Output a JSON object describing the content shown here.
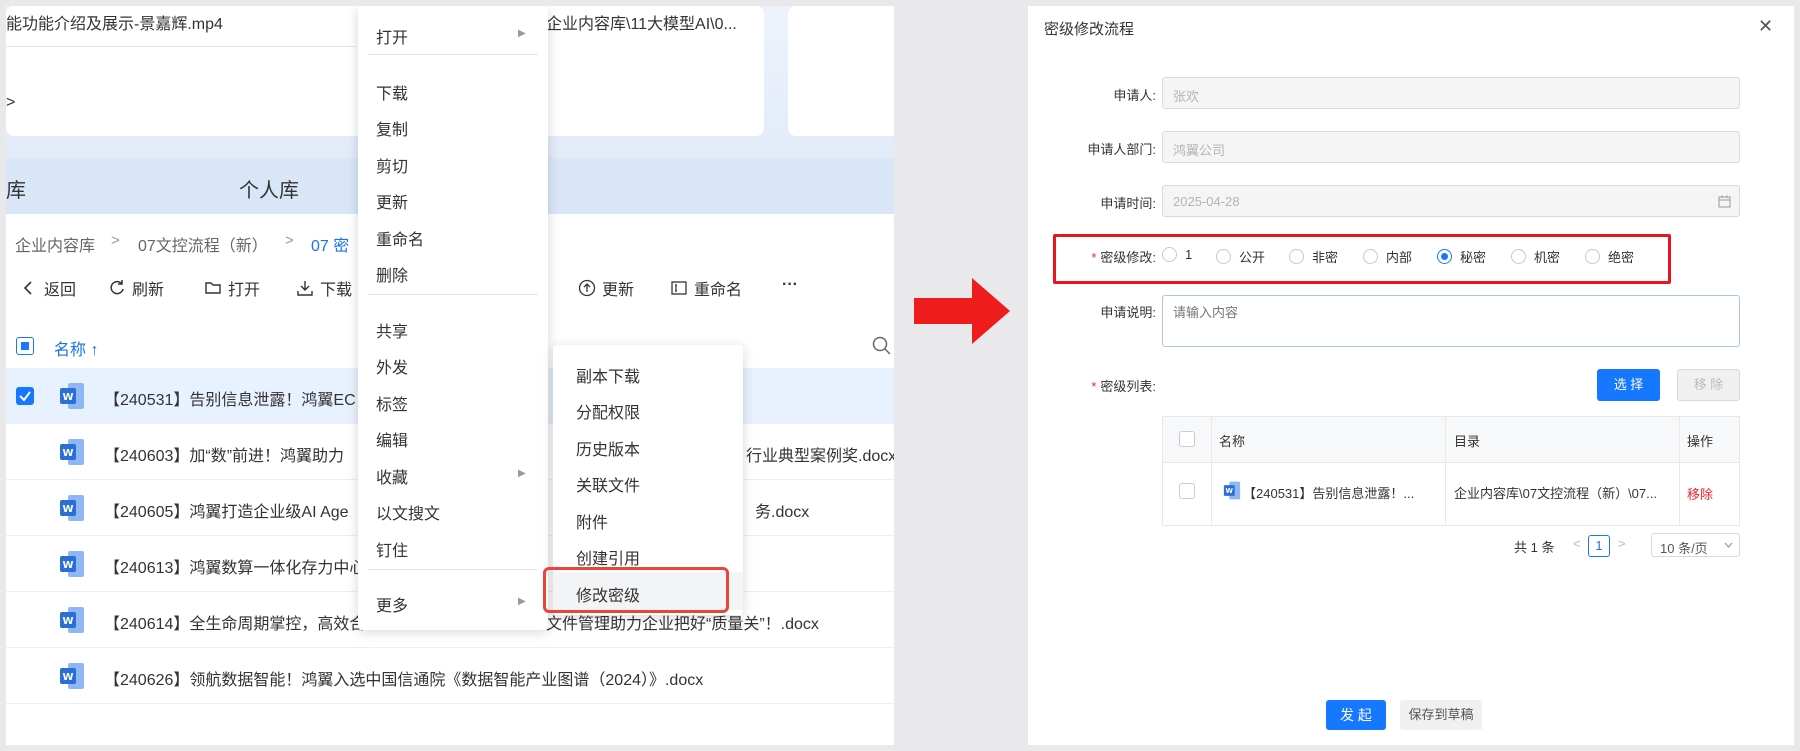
{
  "left_panel": {
    "recent": {
      "video_name": "能功能介绍及展示-景嘉辉.mp4",
      "path_text": "企业内容库\\11大模型AI\\0...",
      "more": ">"
    },
    "tabs": {
      "company": "库",
      "personal": "个人库"
    },
    "breadcrumb": [
      "企业内容库",
      "07文控流程（新）",
      "07 密"
    ],
    "breadcrumb_sep": ">",
    "toolbar": {
      "back": "返回",
      "refresh": "刷新",
      "open": "打开",
      "download": "下载",
      "update": "更新",
      "rename": "重命名",
      "more": "···"
    },
    "table_header": {
      "name": "名称 ↑"
    },
    "files": [
      {
        "left": "【240531】告别信息泄露！鸿翼EC",
        "right": ""
      },
      {
        "left": "【240603】加“数”前进！鸿翼助力",
        "right": "行业典型案例奖.docx"
      },
      {
        "left": "【240605】鸿翼打造企业级AI Age",
        "right": "务.docx"
      },
      {
        "left": "【240613】鸿翼数算一体化存力中心",
        "right": ""
      },
      {
        "left": "【240614】全生命周期掌控，高效合",
        "right": "文件管理助力企业把好“质量关”！.docx"
      },
      {
        "left": "【240626】领航数据智能！鸿翼入选中国信通院《数据智能产业图谱（2024）》.docx",
        "right": ""
      }
    ]
  },
  "context_menu": {
    "items": [
      "打开",
      "下载",
      "复制",
      "剪切",
      "更新",
      "重命名",
      "删除",
      "共享",
      "外发",
      "标签",
      "编辑",
      "收藏",
      "以文搜文",
      "钉住",
      "更多"
    ]
  },
  "submenu": {
    "items": [
      "副本下载",
      "分配权限",
      "历史版本",
      "关联文件",
      "附件",
      "创建引用",
      "修改密级"
    ]
  },
  "dialog": {
    "title": "密级修改流程",
    "close": "✕",
    "fields": {
      "applicant_label": "申请人:",
      "applicant_value": "张欢",
      "dept_label": "申请人部门:",
      "dept_value": "鸿翼公司",
      "time_label": "申请时间:",
      "time_value": "2025-04-28",
      "level_label": "密级修改:",
      "desc_label": "申请说明:",
      "desc_placeholder": "请输入内容",
      "list_label": "密级列表:"
    },
    "levels": [
      "1",
      "公开",
      "非密",
      "内部",
      "秘密",
      "机密",
      "绝密"
    ],
    "selected_level": "秘密",
    "select_button": "选 择",
    "remove_button": "移 除",
    "table": {
      "headers": [
        "名称",
        "目录",
        "操作"
      ],
      "rows": [
        {
          "name": "【240531】告别信息泄露！...",
          "dir": "企业内容库\\07文控流程（新）\\07...",
          "action": "移除"
        }
      ]
    },
    "pagination": {
      "total": "共 1 条",
      "prev": "<",
      "page": "1",
      "next": ">",
      "size": "10 条/页"
    },
    "submit": "发 起",
    "save_draft": "保存到草稿"
  },
  "colors": {
    "accent": "#1677ff",
    "highlight_red": "#e8161e",
    "arrow_red": "#ee1c1c"
  }
}
